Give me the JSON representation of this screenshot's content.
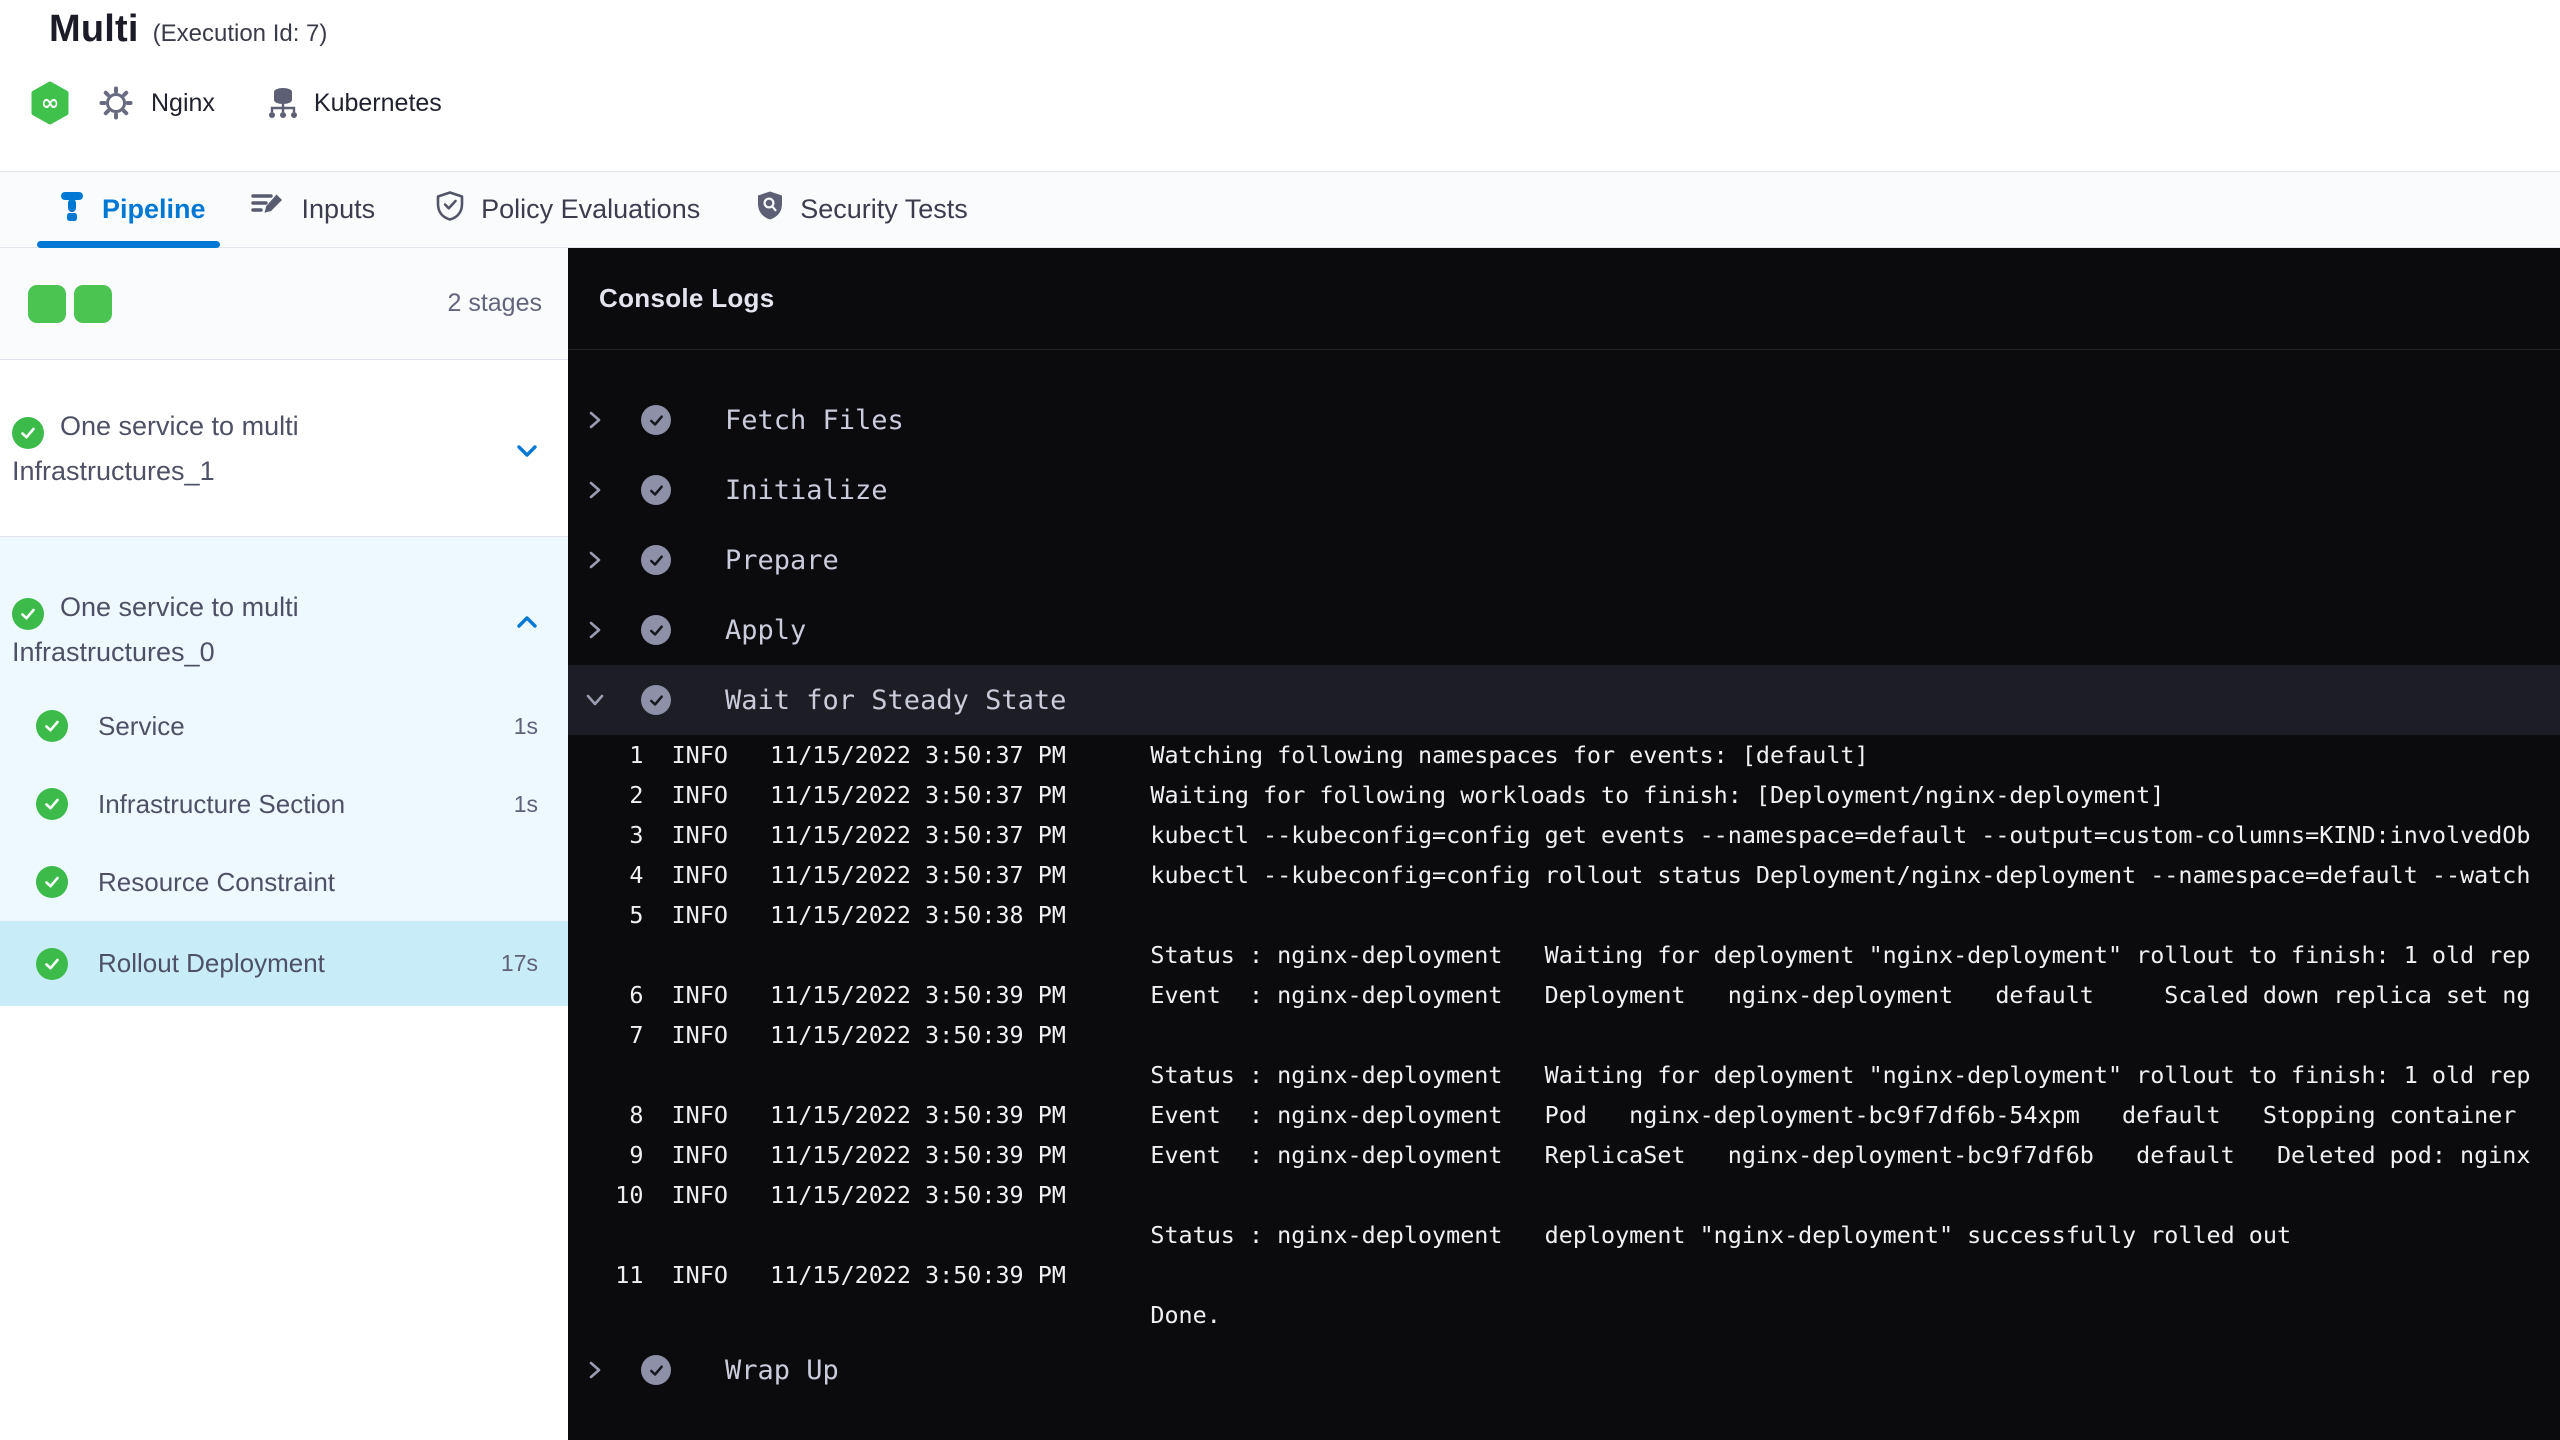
{
  "header": {
    "title": "Multi",
    "execution_id": "(Execution Id: 7)",
    "service": {
      "name": "Nginx"
    },
    "infrastructure": {
      "name": "Kubernetes"
    }
  },
  "tabs": [
    {
      "label": "Pipeline",
      "active": true
    },
    {
      "label": "Inputs",
      "active": false
    },
    {
      "label": "Policy Evaluations",
      "active": false
    },
    {
      "label": "Security Tests",
      "active": false
    }
  ],
  "sidebar": {
    "stage_count": "2 stages",
    "stages": [
      {
        "name": "One service to multi Infrastructures_1",
        "status": "success",
        "expanded": false
      },
      {
        "name": "One service to multi Infrastructures_0",
        "status": "success",
        "expanded": true,
        "steps": [
          {
            "label": "Service",
            "duration": "1s",
            "status": "success",
            "selected": false
          },
          {
            "label": "Infrastructure Section",
            "duration": "1s",
            "status": "success",
            "selected": false
          },
          {
            "label": "Resource Constraint",
            "duration": "",
            "status": "success",
            "selected": false
          },
          {
            "label": "Rollout Deployment",
            "duration": "17s",
            "status": "success",
            "selected": true
          }
        ]
      }
    ]
  },
  "console": {
    "title": "Console Logs",
    "steps": [
      {
        "label": "Fetch Files",
        "status": "success",
        "expanded": false
      },
      {
        "label": "Initialize",
        "status": "success",
        "expanded": false
      },
      {
        "label": "Prepare",
        "status": "success",
        "expanded": false
      },
      {
        "label": "Apply",
        "status": "success",
        "expanded": false
      },
      {
        "label": "Wait for Steady State",
        "status": "success",
        "expanded": true,
        "selected": true,
        "logs": [
          {
            "n": "1",
            "lvl": "INFO",
            "t": "11/15/2022 3:50:37 PM",
            "m": "Watching following namespaces for events: [default]"
          },
          {
            "n": "2",
            "lvl": "INFO",
            "t": "11/15/2022 3:50:37 PM",
            "m": "Waiting for following workloads to finish: [Deployment/nginx-deployment]"
          },
          {
            "n": "3",
            "lvl": "INFO",
            "t": "11/15/2022 3:50:37 PM",
            "m": "kubectl --kubeconfig=config get events --namespace=default --output=custom-columns=KIND:involvedOb"
          },
          {
            "n": "4",
            "lvl": "INFO",
            "t": "11/15/2022 3:50:37 PM",
            "m": "kubectl --kubeconfig=config rollout status Deployment/nginx-deployment --namespace=default --watch"
          },
          {
            "n": "5",
            "lvl": "INFO",
            "t": "11/15/2022 3:50:38 PM",
            "m": ""
          },
          {
            "n": "",
            "lvl": "",
            "t": "",
            "m": "Status : nginx-deployment   Waiting for deployment \"nginx-deployment\" rollout to finish: 1 old rep"
          },
          {
            "n": "6",
            "lvl": "INFO",
            "t": "11/15/2022 3:50:39 PM",
            "m": "Event  : nginx-deployment   Deployment   nginx-deployment   default     Scaled down replica set ng"
          },
          {
            "n": "7",
            "lvl": "INFO",
            "t": "11/15/2022 3:50:39 PM",
            "m": ""
          },
          {
            "n": "",
            "lvl": "",
            "t": "",
            "m": "Status : nginx-deployment   Waiting for deployment \"nginx-deployment\" rollout to finish: 1 old rep"
          },
          {
            "n": "8",
            "lvl": "INFO",
            "t": "11/15/2022 3:50:39 PM",
            "m": "Event  : nginx-deployment   Pod   nginx-deployment-bc9f7df6b-54xpm   default   Stopping container"
          },
          {
            "n": "9",
            "lvl": "INFO",
            "t": "11/15/2022 3:50:39 PM",
            "m": "Event  : nginx-deployment   ReplicaSet   nginx-deployment-bc9f7df6b   default   Deleted pod: nginx"
          },
          {
            "n": "10",
            "lvl": "INFO",
            "t": "11/15/2022 3:50:39 PM",
            "m": ""
          },
          {
            "n": "",
            "lvl": "",
            "t": "",
            "m": "Status : nginx-deployment   deployment \"nginx-deployment\" successfully rolled out"
          },
          {
            "n": "11",
            "lvl": "INFO",
            "t": "11/15/2022 3:50:39 PM",
            "m": ""
          },
          {
            "n": "",
            "lvl": "",
            "t": "",
            "m": "Done."
          }
        ]
      },
      {
        "label": "Wrap Up",
        "status": "success",
        "expanded": false
      }
    ]
  },
  "colors": {
    "accent_blue": "#0278d5",
    "success_green": "#3cbb4b",
    "stage_expanded_bg": "#edf9fe",
    "step_selected_bg": "#c8ecf8",
    "console_bg": "#0b0b0e",
    "console_row_selected_bg": "#1d1e25"
  }
}
